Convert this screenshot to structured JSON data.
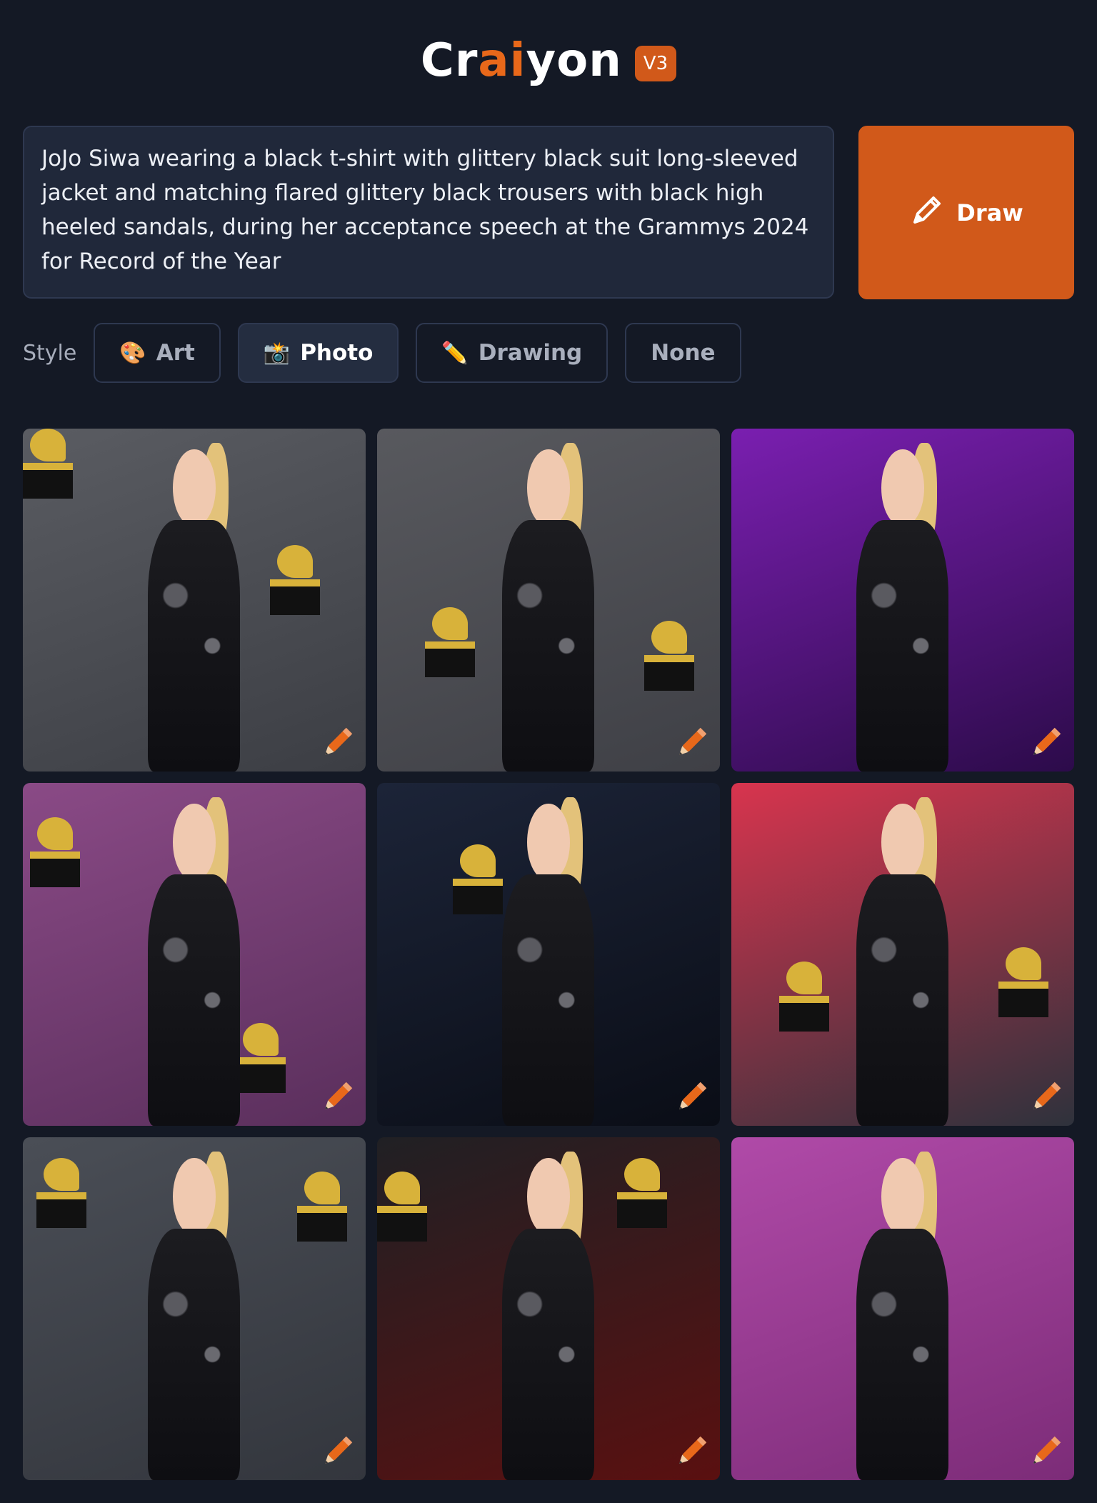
{
  "header": {
    "logo_part1": "Cr",
    "logo_part2": "ai",
    "logo_part3": "yon",
    "version": "V3",
    "accent_color": "#d1591a"
  },
  "prompt": {
    "text": "JoJo Siwa wearing a black t-shirt with glittery black suit long-sleeved jacket and matching flared glittery black trousers with black high heeled sandals, during her acceptance speech at the Grammys 2024 for Record of the Year"
  },
  "draw_button": {
    "label": "Draw",
    "icon": "pencil-icon"
  },
  "style": {
    "label": "Style",
    "options": [
      {
        "label": "Art",
        "icon": "🎨",
        "active": false
      },
      {
        "label": "Photo",
        "icon": "📸",
        "active": true
      },
      {
        "label": "Drawing",
        "icon": "✏️",
        "active": false
      },
      {
        "label": "None",
        "icon": "",
        "active": false
      }
    ]
  },
  "results": {
    "images": [
      {
        "bg": "#5a5c62",
        "bg2": "#3c3e44",
        "trophies": true
      },
      {
        "bg": "#58595e",
        "bg2": "#3f4046",
        "trophies": true
      },
      {
        "bg": "#7a1fb0",
        "bg2": "#2c0b4a",
        "trophies": false
      },
      {
        "bg": "#8a4a86",
        "bg2": "#5a2f5c",
        "trophies": true
      },
      {
        "bg": "#1c2438",
        "bg2": "#0a0d16",
        "trophies": true
      },
      {
        "bg": "#d8344e",
        "bg2": "#2e323c",
        "trophies": true
      },
      {
        "bg": "#4a4e56",
        "bg2": "#33363d",
        "trophies": true
      },
      {
        "bg": "#202024",
        "bg2": "#5a1010",
        "trophies": true
      },
      {
        "bg": "#b04aa8",
        "bg2": "#7c2c78",
        "trophies": false
      }
    ]
  }
}
